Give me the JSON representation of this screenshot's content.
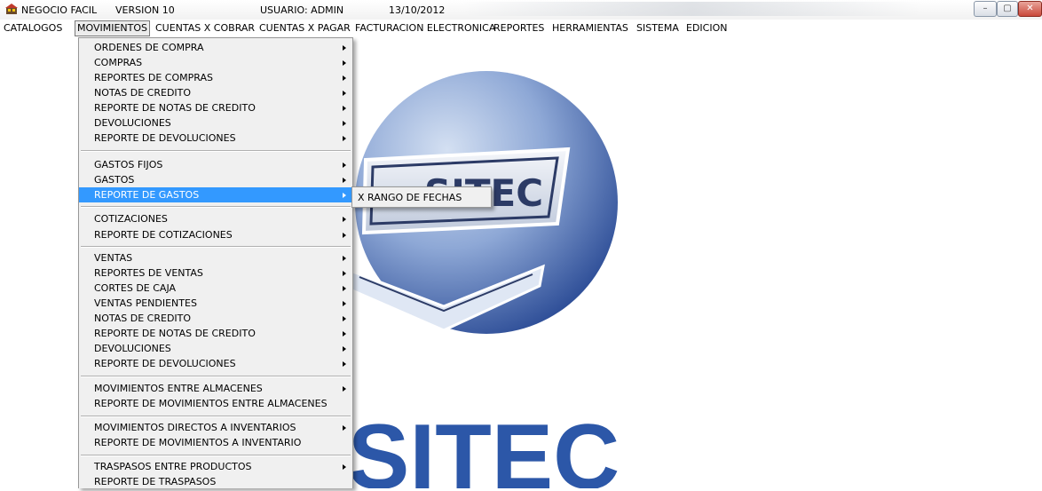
{
  "window": {
    "app_name": "NEGOCIO FACIL",
    "version": "VERSION 10",
    "user": "USUARIO: ADMIN",
    "date": "13/10/2012",
    "controls": {
      "minimize": "–",
      "maximize": "▢",
      "close": "✕"
    }
  },
  "menubar": {
    "items": [
      {
        "label": "CATALOGOS"
      },
      {
        "label": "MOVIMIENTOS",
        "active": true
      },
      {
        "label": "CUENTAS X COBRAR"
      },
      {
        "label": "CUENTAS X PAGAR"
      },
      {
        "label": "FACTURACION ELECTRONICA"
      },
      {
        "label": "REPORTES"
      },
      {
        "label": "HERRAMIENTAS"
      },
      {
        "label": "SISTEMA"
      },
      {
        "label": "EDICION"
      }
    ]
  },
  "dropdown": {
    "items": [
      {
        "label": "ORDENES DE COMPRA",
        "submenu": true
      },
      {
        "label": "COMPRAS",
        "submenu": true
      },
      {
        "label": "REPORTES DE COMPRAS",
        "submenu": true
      },
      {
        "label": "NOTAS DE CREDITO",
        "submenu": true
      },
      {
        "label": "REPORTE DE NOTAS DE CREDITO",
        "submenu": true
      },
      {
        "label": "DEVOLUCIONES",
        "submenu": true
      },
      {
        "label": "REPORTE DE DEVOLUCIONES",
        "submenu": true
      },
      {
        "label": "GASTOS FIJOS",
        "submenu": true
      },
      {
        "label": "GASTOS",
        "submenu": true
      },
      {
        "label": "REPORTE DE GASTOS",
        "submenu": true,
        "highlighted": true
      },
      {
        "label": "COTIZACIONES",
        "submenu": true
      },
      {
        "label": "REPORTE DE COTIZACIONES",
        "submenu": true
      },
      {
        "label": "VENTAS",
        "submenu": true
      },
      {
        "label": "REPORTES DE VENTAS",
        "submenu": true
      },
      {
        "label": "CORTES DE CAJA",
        "submenu": true
      },
      {
        "label": "VENTAS PENDIENTES",
        "submenu": true
      },
      {
        "label": "NOTAS DE CREDITO",
        "submenu": true
      },
      {
        "label": "REPORTE DE NOTAS DE CREDITO",
        "submenu": true
      },
      {
        "label": "DEVOLUCIONES",
        "submenu": true
      },
      {
        "label": "REPORTE DE DEVOLUCIONES",
        "submenu": true
      },
      {
        "label": "MOVIMIENTOS ENTRE ALMACENES",
        "submenu": true
      },
      {
        "label": "REPORTE DE MOVIMIENTOS ENTRE ALMACENES",
        "submenu": false
      },
      {
        "label": "MOVIMIENTOS DIRECTOS A INVENTARIOS",
        "submenu": true
      },
      {
        "label": "REPORTE DE MOVIMIENTOS A INVENTARIO",
        "submenu": false
      },
      {
        "label": "TRASPASOS ENTRE PRODUCTOS",
        "submenu": true
      },
      {
        "label": "REPORTE DE TRASPASOS",
        "submenu": false
      }
    ]
  },
  "submenu": {
    "items": [
      {
        "label": "X RANGO DE FECHAS"
      }
    ]
  },
  "background_logo": {
    "badge_text": "SITEC",
    "big_text": "SITEC",
    "colors": {
      "disc_light": "#b9cdea",
      "disc_dark": "#3c5fa6",
      "text_blue": "#2c57a8"
    }
  }
}
